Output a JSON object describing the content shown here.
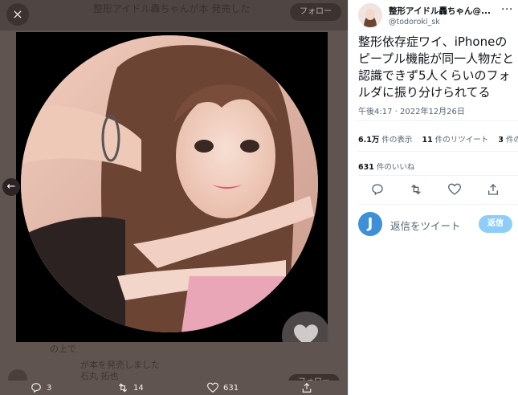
{
  "viewer": {
    "close_icon": "×",
    "bg_text": "整形アイドル轟ちゃんが本 発売した",
    "bg_follow_label": "フォロー",
    "bg_bottom_text_1": "の上で",
    "bg_bottom_text_2": "が本を発売しました",
    "bg_bottom_name": "石丸 拓也",
    "bg_follow2_label": "フォロー",
    "nav_left": "←"
  },
  "actions": {
    "reply_count": "3",
    "retweet_count": "14",
    "like_count": "631"
  },
  "tweet": {
    "display_name": "整形アイドル轟ちゃん@...",
    "handle": "@todoroki_sk",
    "more": "···",
    "text": "整形依存症ワイ、iPhoneのピープル機能が同一人物だと認識できず5人くらいのフォルダに振り分けられてる",
    "timestamp": "午後4:17 · 2022年12月26日",
    "views_count": "6.1万",
    "views_label": " 件の表示",
    "retweets_count": "11",
    "retweets_label": " 件のリツイート",
    "quotes_count": "3",
    "quotes_label": " 件の引",
    "likes_count": "631",
    "likes_label": " 件のいいね"
  },
  "reply": {
    "avatar_letter": "J",
    "placeholder": "返信をツイート",
    "button_label": "返信"
  },
  "colors": {
    "viewer_bg": "#5f5450",
    "accent_blue": "#1d9bf0",
    "reply_button_disabled": "#8ecdf8"
  }
}
